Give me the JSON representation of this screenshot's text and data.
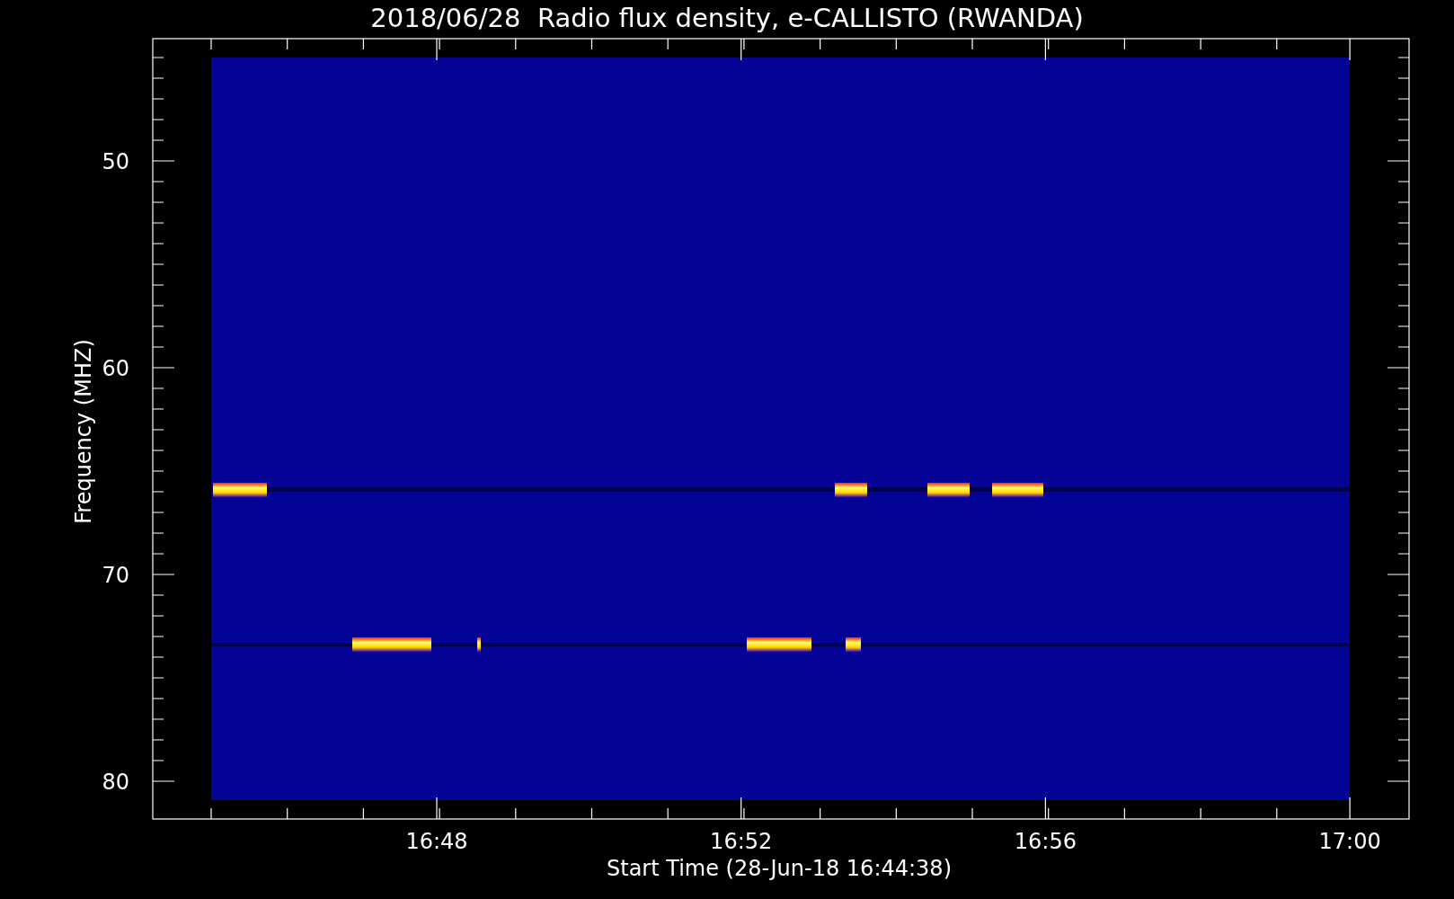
{
  "plot": {
    "title": "2018/06/28  Radio flux density, e-CALLISTO (RWANDA)",
    "xlabel": "Start Time (28-Jun-18 16:44:38)",
    "ylabel": "Frequency (MHZ)",
    "xticks": [
      "16:48",
      "16:52",
      "16:56",
      "17:00"
    ],
    "yticks": [
      "50",
      "60",
      "70",
      "80"
    ]
  }
}
